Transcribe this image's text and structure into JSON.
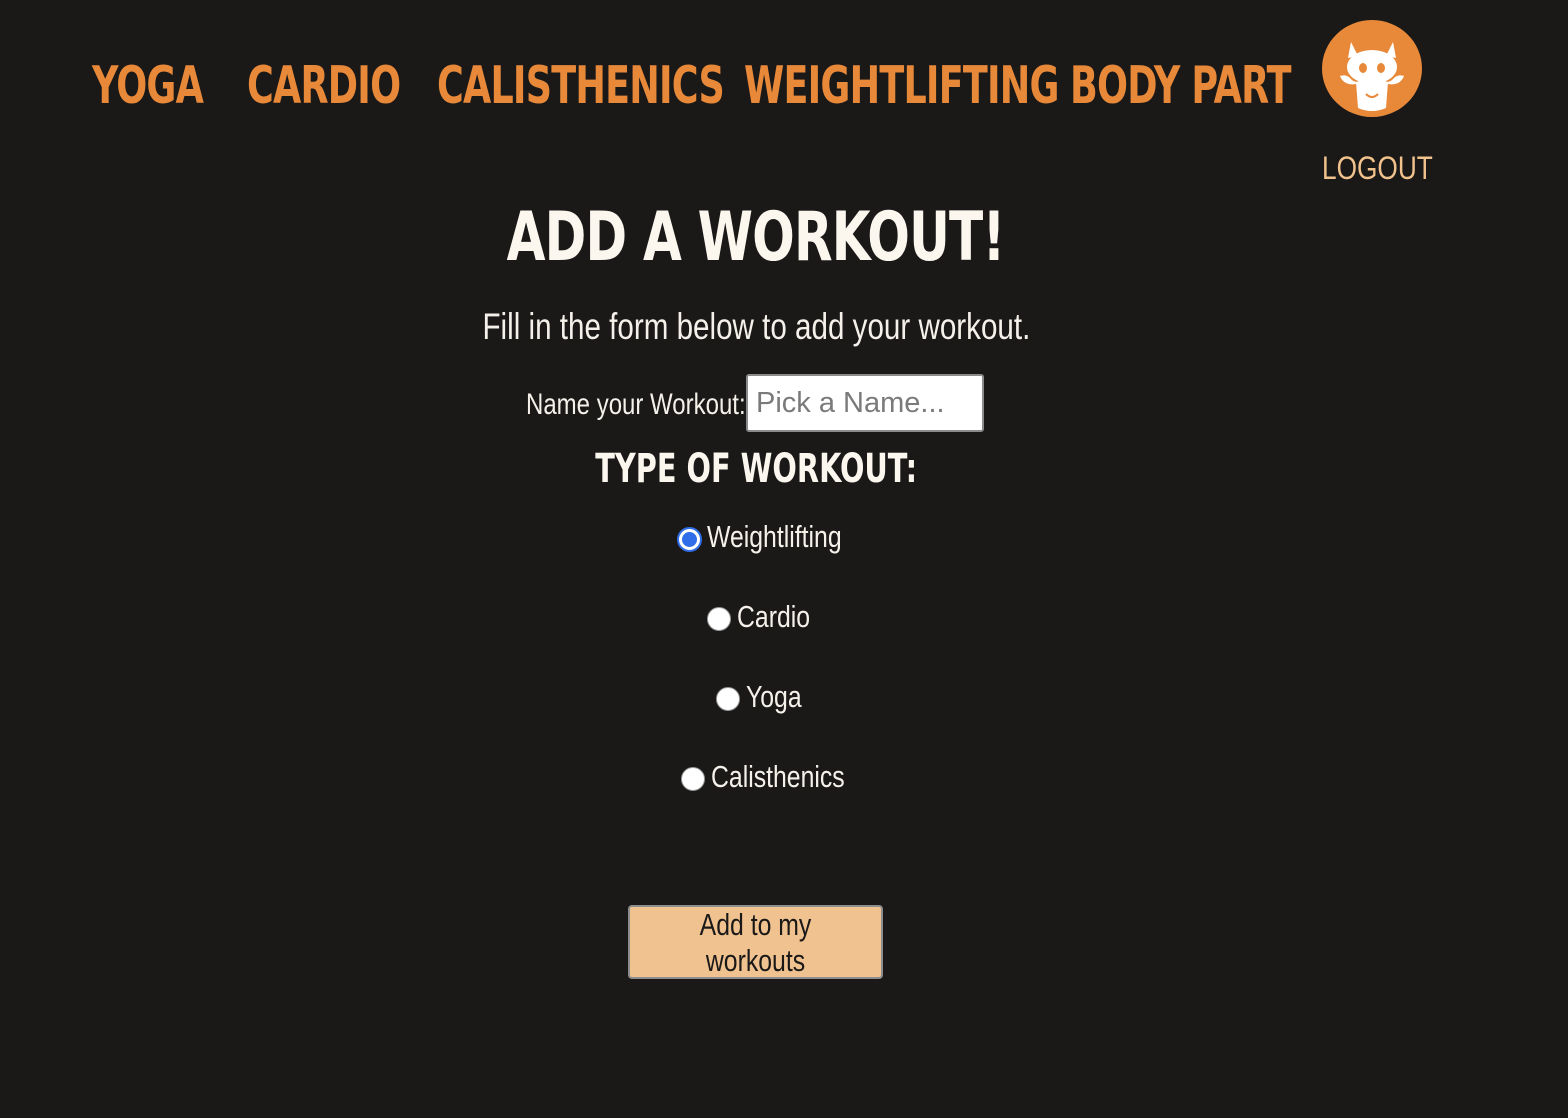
{
  "nav": {
    "items": [
      {
        "label": "YOGA"
      },
      {
        "label": "CARDIO"
      },
      {
        "label": "CALISTHENICS"
      },
      {
        "label": "WEIGHTLIFTING"
      },
      {
        "label": "BODY PART"
      }
    ],
    "avatar_icon": "github-octocat-icon",
    "logout_label": "LOGOUT",
    "accent_color": "#e8893a"
  },
  "form": {
    "title": "ADD A WORKOUT!",
    "subtitle": "Fill in the form below to add your workout.",
    "name_label": "Name your Workout:",
    "name_placeholder": "Pick a Name...",
    "name_value": "",
    "type_heading": "TYPE OF WORKOUT:",
    "types": [
      {
        "label": "Weightlifting",
        "checked": true
      },
      {
        "label": "Cardio",
        "checked": false
      },
      {
        "label": "Yoga",
        "checked": false
      },
      {
        "label": "Calisthenics",
        "checked": false
      }
    ],
    "submit_label": "Add to my workouts",
    "button_color": "#f0c290",
    "background_color": "#1a1918"
  }
}
